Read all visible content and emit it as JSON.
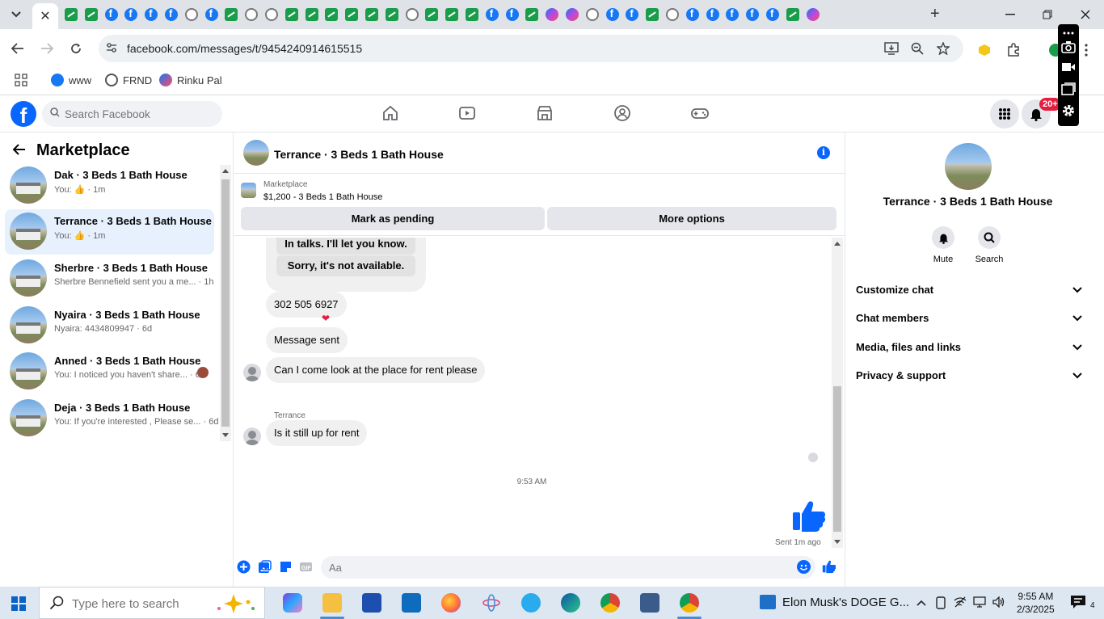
{
  "browser": {
    "address_url": "facebook.com/messages/t/9454240914615515",
    "bookmarks": [
      {
        "label": "www"
      },
      {
        "label": "FRND"
      },
      {
        "label": "Rinku Pal"
      }
    ],
    "active_tab_close": "✕",
    "new_tab": "+",
    "favicons": [
      "green",
      "green",
      "fb",
      "fb",
      "fb",
      "fb",
      "globe",
      "fb",
      "green",
      "globe",
      "globe",
      "green",
      "green",
      "green",
      "green",
      "green",
      "green",
      "globe",
      "green",
      "green",
      "green",
      "fb",
      "fb",
      "green",
      "msg",
      "msg",
      "globe",
      "fb",
      "fb",
      "green",
      "globe",
      "fb",
      "fb",
      "fb",
      "fb",
      "fb",
      "green",
      "msg"
    ]
  },
  "facebook": {
    "search_placeholder": "Search Facebook",
    "notification_badge": "20+"
  },
  "left_panel": {
    "title": "Marketplace",
    "conversations": [
      {
        "name": "Dak · 3 Beds 1 Bath House",
        "snippet": "You: 👍 · 1m",
        "active": false
      },
      {
        "name": "Terrance · 3 Beds 1 Bath House",
        "snippet": "You: 👍 · 1m",
        "active": true
      },
      {
        "name": "Sherbre · 3 Beds 1 Bath House",
        "snippet": "Sherbre Bennefield sent you a me... · 1h",
        "active": false
      },
      {
        "name": "Nyaira · 3 Beds 1 Bath House",
        "snippet": "Nyaira: 4434809947 · 6d",
        "active": false
      },
      {
        "name": "Anned · 3 Beds 1 Bath House",
        "snippet": "You: I noticed you haven't share... · 6d",
        "active": false
      },
      {
        "name": "Deja · 3 Beds 1 Bath House",
        "snippet": "You: If you're interested , Please se... · 6d",
        "active": false
      }
    ]
  },
  "chat": {
    "title": "Terrance · 3 Beds 1 Bath House",
    "listing": {
      "source": "Marketplace",
      "price_line": "$1,200 - 3 Beds 1 Bath House",
      "mark_pending": "Mark as pending",
      "more_options": "More options"
    },
    "quick_replies": [
      "In talks. I'll let you know.",
      "Sorry, it's not available."
    ],
    "messages": [
      {
        "text": "302 505 6927"
      },
      {
        "text": "Message sent"
      },
      {
        "text": "Can I come look at the place for rent please"
      },
      {
        "text": "Is it still up for rent"
      }
    ],
    "sender_name": "Terrance",
    "time_separator": "9:53 AM",
    "sent_status": "Sent 1m ago",
    "composer_placeholder": "Aa"
  },
  "right_panel": {
    "name": "Terrance · 3 Beds 1 Bath House",
    "actions": [
      {
        "label": "Mute"
      },
      {
        "label": "Search"
      }
    ],
    "sections": [
      {
        "label": "Customize chat"
      },
      {
        "label": "Chat members"
      },
      {
        "label": "Media, files and links"
      },
      {
        "label": "Privacy & support"
      }
    ]
  },
  "taskbar": {
    "search_placeholder": "Type here to search",
    "news_text": "Elon Musk's DOGE G...",
    "time": "9:55 AM",
    "date": "2/3/2025",
    "notification_count": "4"
  },
  "colors": {
    "facebook_blue": "#0866ff",
    "active_conversation": "#e7f0fd",
    "badge_red": "#e41e3f",
    "bubble_gray": "#f0f0f0"
  }
}
